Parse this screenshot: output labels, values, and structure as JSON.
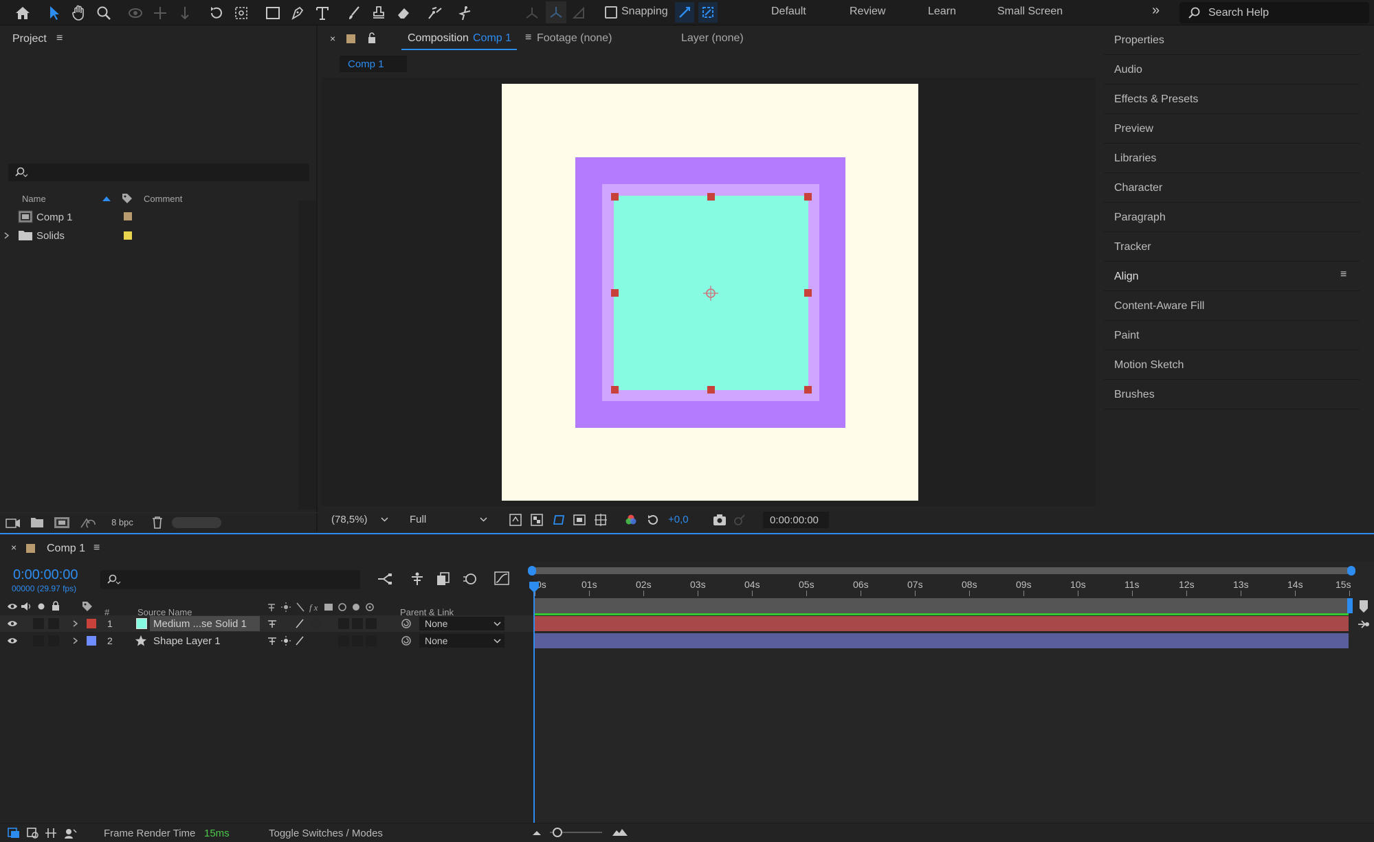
{
  "toolbar": {
    "snapping_label": "Snapping",
    "workspaces": [
      "Default",
      "Review",
      "Learn",
      "Small Screen"
    ],
    "search_placeholder": "Search Help"
  },
  "project": {
    "title": "Project",
    "columns": {
      "name": "Name",
      "comment": "Comment"
    },
    "items": [
      {
        "name": "Comp 1",
        "type": "composition",
        "label_color": "#b89b6e"
      },
      {
        "name": "Solids",
        "type": "folder",
        "label_color": "#e8d44d"
      }
    ],
    "footer_bpc": "8 bpc"
  },
  "composition": {
    "tabs": [
      {
        "label": "Composition",
        "name": "Comp 1"
      },
      {
        "label": "Footage (none)"
      },
      {
        "label": "Layer (none)"
      }
    ],
    "breadcrumb": "Comp 1",
    "zoom": "(78,5%)",
    "resolution": "Full",
    "exposure": "+0,0",
    "timecode": "0:00:00:00",
    "colors": {
      "background": "#fffcea",
      "outer": "#b57bff",
      "middle": "#cfa6ff",
      "inner": "#86fbe2"
    }
  },
  "right_panels": [
    "Properties",
    "Audio",
    "Effects & Presets",
    "Preview",
    "Libraries",
    "Character",
    "Paragraph",
    "Tracker",
    "Align",
    "Content-Aware Fill",
    "Paint",
    "Motion Sketch",
    "Brushes"
  ],
  "timeline": {
    "comp_name": "Comp 1",
    "timecode": "0:00:00:00",
    "frame_info": "00000 (29.97 fps)",
    "columns": {
      "num": "#",
      "source": "Source Name",
      "parent": "Parent & Link"
    },
    "layers": [
      {
        "num": "1",
        "name": "Medium ...se Solid 1",
        "label_color": "#c8413a",
        "parent": "None",
        "bar_color": "#a84848"
      },
      {
        "num": "2",
        "name": "Shape Layer 1",
        "label_color": "#6f8dff",
        "parent": "None",
        "bar_color": "#5a5f9c"
      }
    ],
    "ruler": [
      "0s",
      "01s",
      "02s",
      "03s",
      "04s",
      "05s",
      "06s",
      "07s",
      "08s",
      "09s",
      "10s",
      "11s",
      "12s",
      "13s",
      "14s",
      "15s"
    ],
    "footer": {
      "frame_render_label": "Frame Render Time",
      "frame_render_value": "15ms",
      "toggle": "Toggle Switches / Modes"
    }
  }
}
